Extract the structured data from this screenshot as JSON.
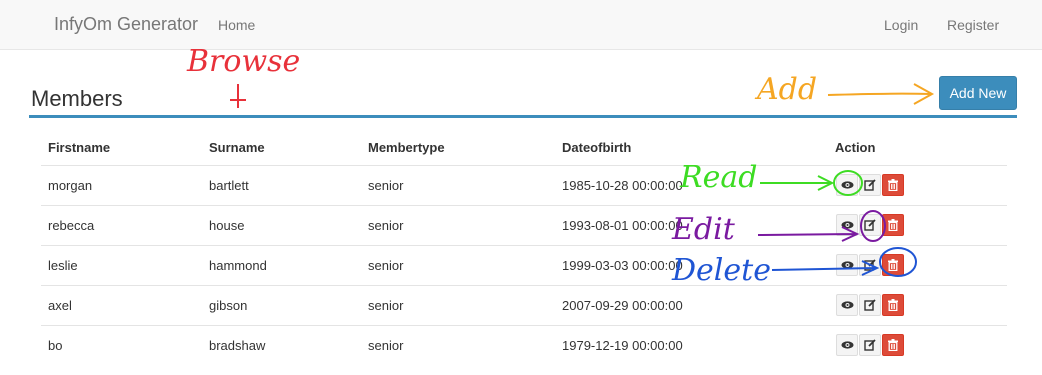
{
  "navbar": {
    "brand": "InfyOm Generator",
    "home": "Home",
    "login": "Login",
    "register": "Register"
  },
  "page": {
    "title": "Members",
    "add_button": "Add New"
  },
  "table": {
    "headers": [
      "Firstname",
      "Surname",
      "Membertype",
      "Dateofbirth",
      "Action"
    ],
    "rows": [
      [
        "morgan",
        "bartlett",
        "senior",
        "1985-10-28 00:00:00"
      ],
      [
        "rebecca",
        "house",
        "senior",
        "1993-08-01 00:00:00"
      ],
      [
        "leslie",
        "hammond",
        "senior",
        "1999-03-03 00:00:00"
      ],
      [
        "axel",
        "gibson",
        "senior",
        "2007-09-29 00:00:00"
      ],
      [
        "bo",
        "bradshaw",
        "senior",
        "1979-12-19 00:00:00"
      ]
    ],
    "row_actions": [
      "view-icon",
      "edit-icon",
      "trash-icon"
    ]
  },
  "annotations": {
    "browse": "Browse",
    "add": "Add",
    "read": "Read",
    "edit": "Edit",
    "delete": "Delete"
  },
  "colors": {
    "primary": "#3c8dbc",
    "danger": "#dd4b39",
    "annot_browse": "#e8313a",
    "annot_add": "#f5a623",
    "annot_read": "#3ddc23",
    "annot_edit": "#7a1aa0",
    "annot_delete": "#1f55d4"
  }
}
